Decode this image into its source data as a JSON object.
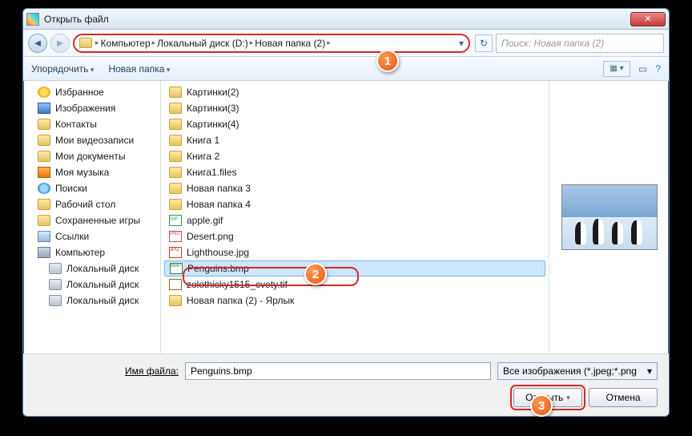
{
  "window": {
    "title": "Открыть файл"
  },
  "breadcrumb": {
    "root": "Компьютер",
    "part2": "Локальный диск (D:)",
    "part3": "Новая папка (2)"
  },
  "search": {
    "placeholder": "Поиск: Новая папка (2)"
  },
  "toolbar": {
    "organize": "Упорядочить",
    "newfolder": "Новая папка"
  },
  "sidebar": {
    "items": [
      {
        "label": "Избранное",
        "cls": "ico-star",
        "lvl": 1
      },
      {
        "label": "Изображения",
        "cls": "ico-pic",
        "lvl": 1
      },
      {
        "label": "Контакты",
        "cls": "ico-folder",
        "lvl": 1
      },
      {
        "label": "Мои видеозаписи",
        "cls": "ico-folder",
        "lvl": 1
      },
      {
        "label": "Мои документы",
        "cls": "ico-folder",
        "lvl": 1
      },
      {
        "label": "Моя музыка",
        "cls": "ico-mus",
        "lvl": 1
      },
      {
        "label": "Поиски",
        "cls": "ico-search",
        "lvl": 1
      },
      {
        "label": "Рабочий стол",
        "cls": "ico-folder",
        "lvl": 1
      },
      {
        "label": "Сохраненные игры",
        "cls": "ico-folder",
        "lvl": 1
      },
      {
        "label": "Ссылки",
        "cls": "ico-link",
        "lvl": 1
      },
      {
        "label": "Компьютер",
        "cls": "ico-comp",
        "lvl": 1
      },
      {
        "label": "Локальный диск",
        "cls": "ico-disk",
        "lvl": 2
      },
      {
        "label": "Локальный диск",
        "cls": "ico-disk",
        "lvl": 2
      },
      {
        "label": "Локальный диск",
        "cls": "ico-disk",
        "lvl": 2
      }
    ]
  },
  "files": {
    "items": [
      {
        "label": "Картинки(2)",
        "cls": "ico-folder"
      },
      {
        "label": "Картинки(3)",
        "cls": "ico-folder"
      },
      {
        "label": "Картинки(4)",
        "cls": "ico-folder"
      },
      {
        "label": "Книга 1",
        "cls": "ico-folder"
      },
      {
        "label": "Книга 2",
        "cls": "ico-folder"
      },
      {
        "label": "Книга1.files",
        "cls": "ico-folder"
      },
      {
        "label": "Новая папка 3",
        "cls": "ico-folder"
      },
      {
        "label": "Новая папка 4",
        "cls": "ico-folder"
      },
      {
        "label": "apple.gif",
        "cls": "ico-gif"
      },
      {
        "label": "Desert.png",
        "cls": "ico-png"
      },
      {
        "label": "Lighthouse.jpg",
        "cls": "ico-jpg"
      },
      {
        "label": "Penguins.bmp",
        "cls": "ico-bmp",
        "selected": true
      },
      {
        "label": "zolothicky1515_cvety.tif",
        "cls": "ico-tif"
      },
      {
        "label": "Новая папка (2) - Ярлык",
        "cls": "ico-folder"
      }
    ]
  },
  "footer": {
    "filename_label": "Имя файла:",
    "filename_value": "Penguins.bmp",
    "filter": "Все изображения (*.jpeg;*.png",
    "open": "Открыть",
    "cancel": "Отмена"
  },
  "callouts": {
    "c1": "1",
    "c2": "2",
    "c3": "3"
  }
}
